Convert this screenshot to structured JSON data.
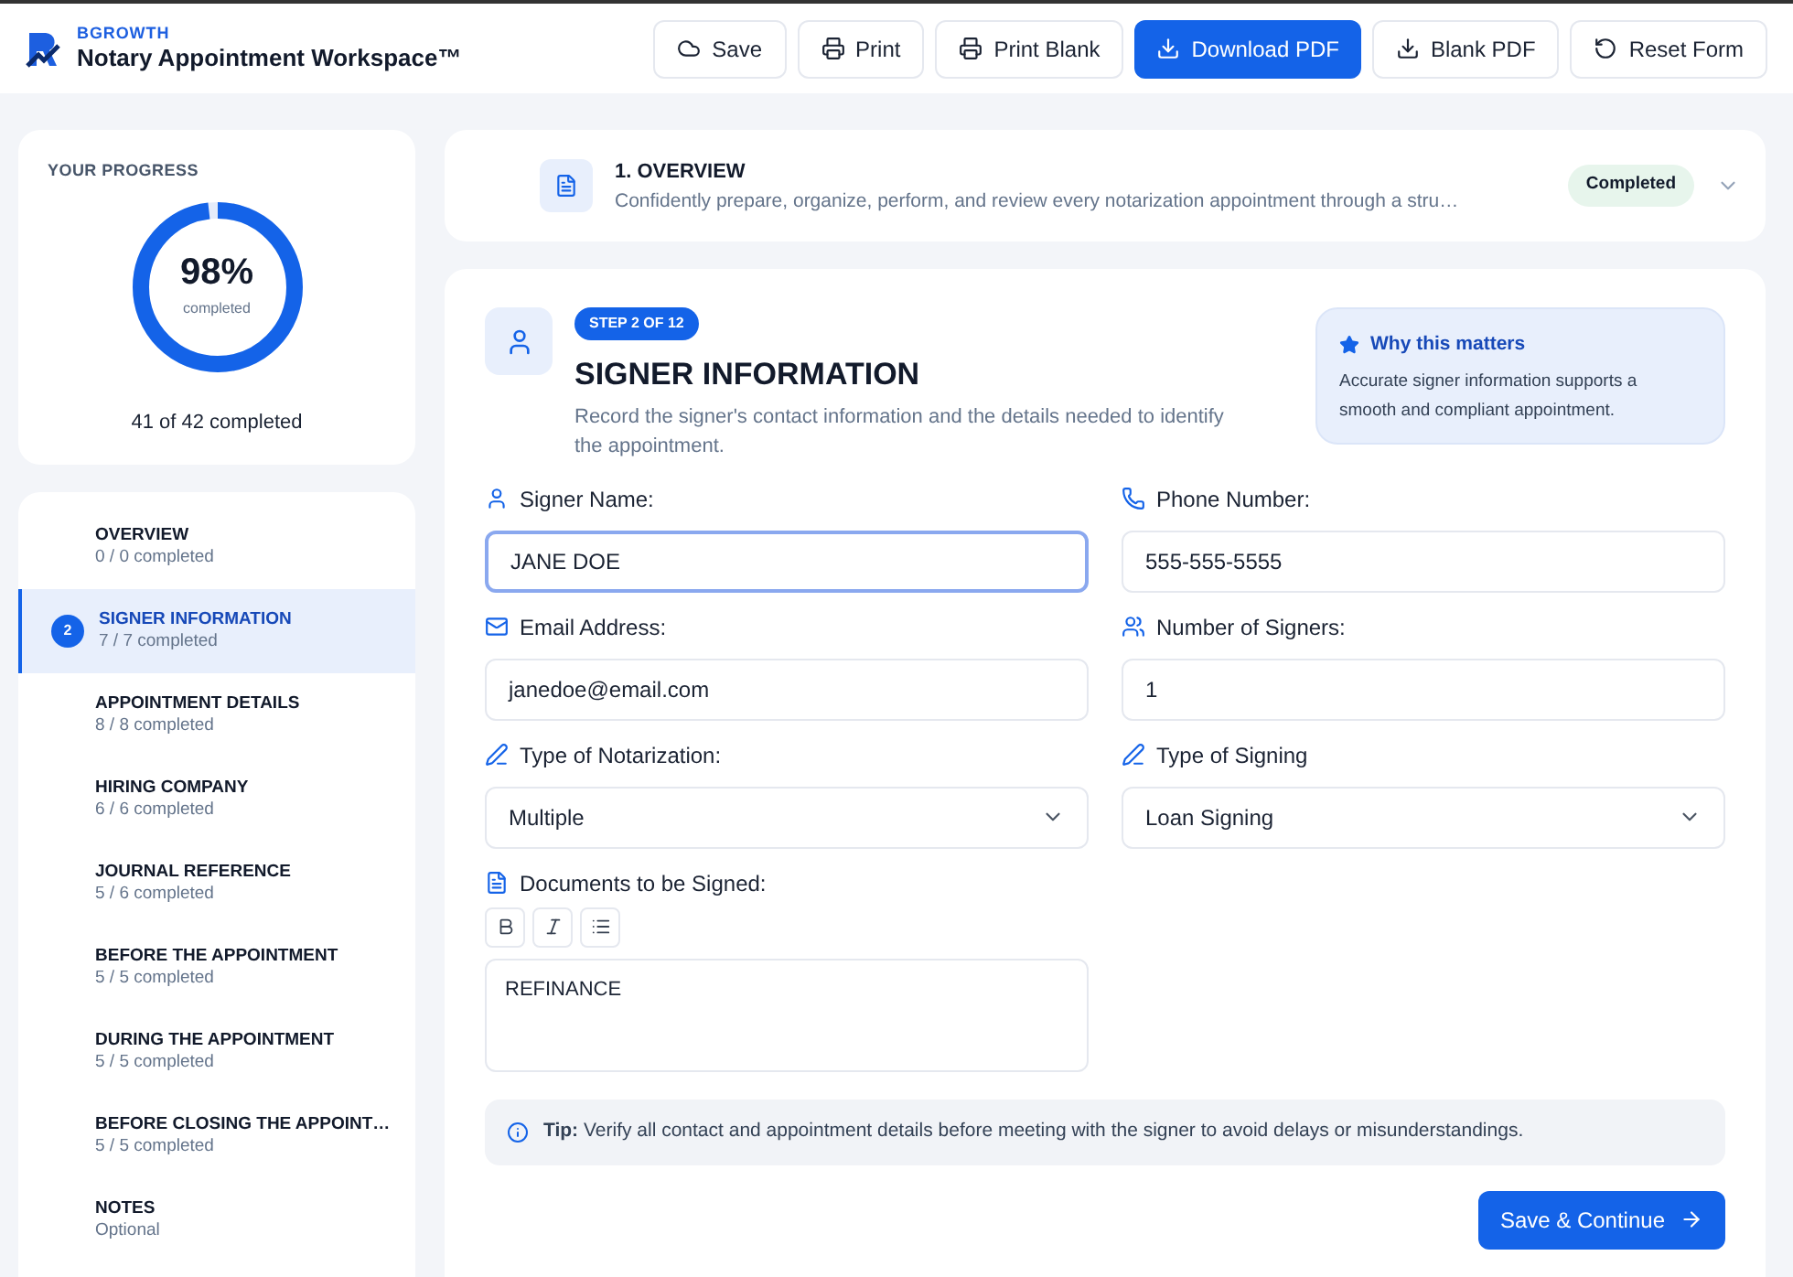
{
  "brand": {
    "company": "BGROWTH",
    "title": "Notary Appointment Workspace™"
  },
  "toolbar": [
    {
      "label": "Save",
      "kind": "save",
      "primary": false
    },
    {
      "label": "Print",
      "kind": "print",
      "primary": false
    },
    {
      "label": "Print Blank",
      "kind": "print",
      "primary": false
    },
    {
      "label": "Download PDF",
      "kind": "download",
      "primary": true
    },
    {
      "label": "Blank PDF",
      "kind": "download",
      "primary": false
    },
    {
      "label": "Reset Form",
      "kind": "reset",
      "primary": false
    }
  ],
  "progress": {
    "heading": "YOUR PROGRESS",
    "percent": "98%",
    "caption": "completed",
    "level": 0.98,
    "summary": "41 of 42 completed"
  },
  "sections": [
    {
      "title": "OVERVIEW",
      "subtitle": "0 / 0 completed",
      "selected": false
    },
    {
      "title": "SIGNER INFORMATION",
      "subtitle": "7 / 7 completed",
      "selected": true,
      "badge": "2"
    },
    {
      "title": "APPOINTMENT DETAILS",
      "subtitle": "8 / 8 completed",
      "selected": false
    },
    {
      "title": "HIRING COMPANY",
      "subtitle": "6 / 6 completed",
      "selected": false
    },
    {
      "title": "JOURNAL REFERENCE",
      "subtitle": "5 / 6 completed",
      "selected": false
    },
    {
      "title": "BEFORE THE APPOINTMENT",
      "subtitle": "5 / 5 completed",
      "selected": false
    },
    {
      "title": "DURING THE APPOINTMENT",
      "subtitle": "5 / 5 completed",
      "selected": false
    },
    {
      "title": "BEFORE CLOSING THE APPOINT…",
      "subtitle": "5 / 5 completed",
      "selected": false
    },
    {
      "title": "NOTES",
      "subtitle": "Optional",
      "selected": false
    }
  ],
  "overview": {
    "title": "1. OVERVIEW",
    "description": "Confidently prepare, organize, perform, and review every notarization appointment through a stru…",
    "status": "Completed",
    "expanded": false
  },
  "step": {
    "badge": "STEP 2 OF 12",
    "title": "SIGNER INFORMATION",
    "description": "Record the signer's contact information and the details needed to identify the appointment.",
    "callout": {
      "title": "Why this matters",
      "text": "Accurate signer information supports a smooth and compliant appointment."
    },
    "fields": [
      {
        "label": "Signer Name:",
        "kind": "text",
        "value": "JANE DOE",
        "focused": true
      },
      {
        "label": "Phone Number:",
        "kind": "text",
        "value": "555-555-5555",
        "focused": false
      },
      {
        "label": "Email Address:",
        "kind": "text",
        "value": "janedoe@email.com",
        "focused": false
      },
      {
        "label": "Number of Signers:",
        "kind": "text",
        "value": "1",
        "focused": false
      },
      {
        "label": "Type of Notarization:",
        "kind": "select",
        "value": "Multiple",
        "focused": false
      },
      {
        "label": "Type of Signing",
        "kind": "select",
        "value": "Loan Signing",
        "focused": false
      },
      {
        "label": "Documents to be Signed:",
        "kind": "richtext",
        "value": "REFINANCE",
        "focused": false
      }
    ],
    "tip": "**Tip:** Verify all contact and appointment details before meeting with the signer to avoid delays or misunderstandings.",
    "continue": "Save & Continue"
  }
}
